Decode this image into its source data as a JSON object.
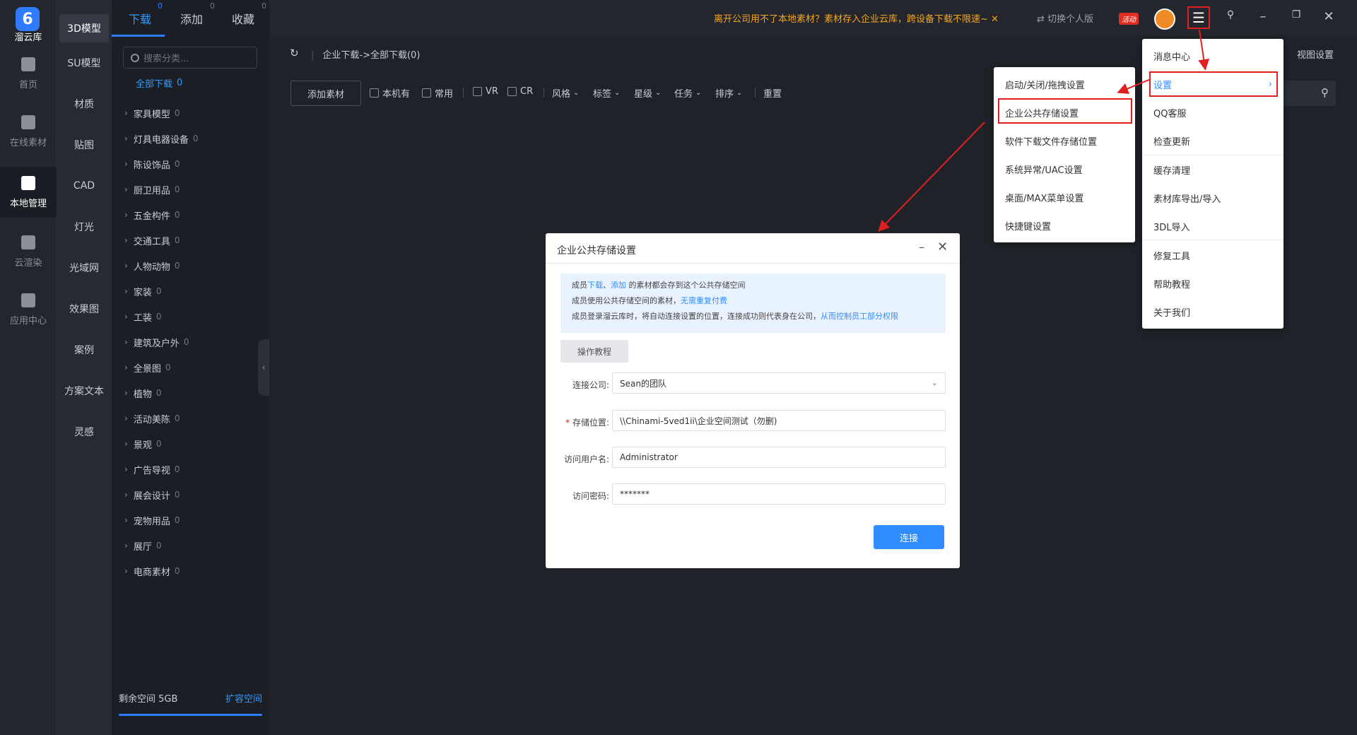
{
  "app": {
    "logo_char": "6",
    "logo_name": "溜云库"
  },
  "left_nav": [
    {
      "label": "首页",
      "icon": "home-icon"
    },
    {
      "label": "在线素材",
      "icon": "grid-icon"
    },
    {
      "label": "本地管理",
      "icon": "monitor-icon",
      "active": true
    },
    {
      "label": "云渲染",
      "icon": "cloud-icon"
    },
    {
      "label": "应用中心",
      "icon": "apps-icon"
    }
  ],
  "categories": [
    "3D模型",
    "SU模型",
    "材质",
    "贴图",
    "CAD",
    "灯光",
    "光域网",
    "效果图",
    "案例",
    "方案文本",
    "灵感"
  ],
  "tabs": [
    {
      "label": "下载",
      "count": "0"
    },
    {
      "label": "添加",
      "count": "0"
    },
    {
      "label": "收藏",
      "count": "0"
    }
  ],
  "search": {
    "placeholder": "搜索分类..."
  },
  "tree": {
    "all_label": "全部下载",
    "all_count": "0",
    "items": [
      {
        "label": "家具模型",
        "count": "0"
      },
      {
        "label": "灯具电器设备",
        "count": "0"
      },
      {
        "label": "陈设饰品",
        "count": "0"
      },
      {
        "label": "厨卫用品",
        "count": "0"
      },
      {
        "label": "五金构件",
        "count": "0"
      },
      {
        "label": "交通工具",
        "count": "0"
      },
      {
        "label": "人物动物",
        "count": "0"
      },
      {
        "label": "家装",
        "count": "0"
      },
      {
        "label": "工装",
        "count": "0"
      },
      {
        "label": "建筑及户外",
        "count": "0"
      },
      {
        "label": "全景图",
        "count": "0"
      },
      {
        "label": "植物",
        "count": "0"
      },
      {
        "label": "活动美陈",
        "count": "0"
      },
      {
        "label": "景观",
        "count": "0"
      },
      {
        "label": "广告导视",
        "count": "0"
      },
      {
        "label": "展会设计",
        "count": "0"
      },
      {
        "label": "宠物用品",
        "count": "0"
      },
      {
        "label": "展厅",
        "count": "0"
      },
      {
        "label": "电商素材",
        "count": "0"
      }
    ]
  },
  "space": {
    "label": "剩余空间 5GB",
    "expand": "扩容空间"
  },
  "topbar": {
    "promo": "离开公司用不了本地素材？素材存入企业云库，跨设备下载不限速~ ✕",
    "switch": "⇄ 切换个人版",
    "badge": "活动"
  },
  "breadcrumb": "企业下载->全部下载(0)",
  "view_settings": "视图设置",
  "toolbar": {
    "add_label": "添加素材",
    "checks": [
      "本机有",
      "常用",
      "VR",
      "CR"
    ],
    "dropdowns": [
      "风格",
      "标签",
      "星级",
      "任务",
      "排序"
    ],
    "reset": "重置"
  },
  "dialog": {
    "title": "企业公共存储设置",
    "info": {
      "l1a": "成员",
      "l1_link1": "下载",
      "l1_sep": "、",
      "l1_link2": "添加",
      "l1b": " 的素材都会存到这个公共存储空间",
      "l2a": "成员使用公共存储空间的素材，",
      "l2_link": "无需重复付费",
      "l3a": "成员登录溜云库时，将自动连接设置的位置，连接成功则代表身在公司，",
      "l3_link": "从而控制员工部分权限"
    },
    "tutorial": "操作教程",
    "fields": {
      "company_label": "连接公司:",
      "company_value": "Sean的团队",
      "location_label": "存储位置:",
      "location_value": "\\\\Chinami-5ved1ii\\企业空间测试（勿删)",
      "user_label": "访问用户名:",
      "user_value": "Administrator",
      "password_label": "访问密码:",
      "password_value": "*******"
    },
    "connect": "连接"
  },
  "main_menu": [
    {
      "label": "消息中心"
    },
    {
      "label": "设置",
      "highlight": true
    },
    {
      "label": "QQ客服"
    },
    {
      "label": "检查更新"
    },
    {
      "label": "缓存清理"
    },
    {
      "label": "素材库导出/导入"
    },
    {
      "label": "3DL导入"
    },
    {
      "label": "修复工具"
    },
    {
      "label": "帮助教程"
    },
    {
      "label": "关于我们"
    }
  ],
  "sub_menu": [
    {
      "label": "启动/关闭/拖拽设置"
    },
    {
      "label": "企业公共存储设置",
      "highlight": true
    },
    {
      "label": "软件下载文件存储位置"
    },
    {
      "label": "系统异常/UAC设置"
    },
    {
      "label": "桌面/MAX菜单设置"
    },
    {
      "label": "快捷键设置"
    }
  ],
  "colors": {
    "accent": "#2f7bff",
    "annotation": "#e02020",
    "promo": "#f5a623"
  }
}
